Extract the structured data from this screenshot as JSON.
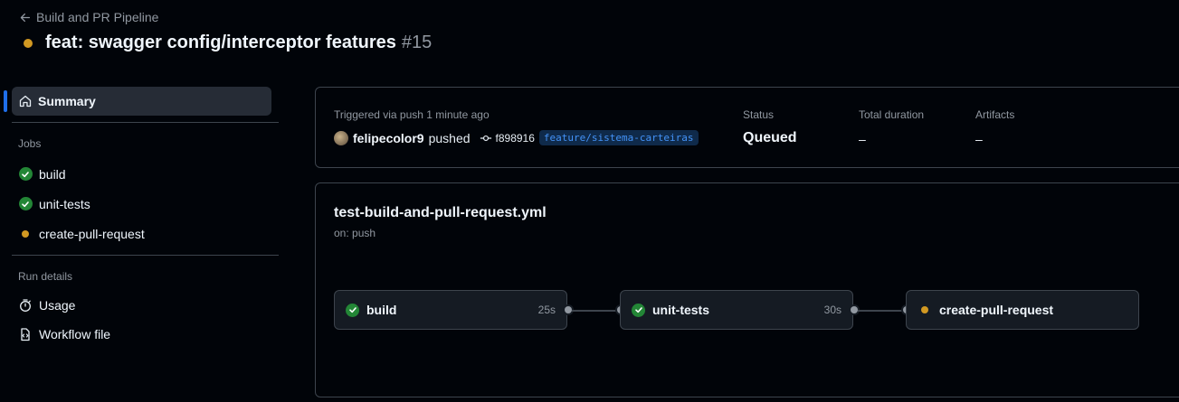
{
  "header": {
    "back_label": "Build and PR Pipeline",
    "title": "feat: swagger config/interceptor features",
    "run_number": "#15",
    "status_color": "#d29922"
  },
  "sidebar": {
    "summary_label": "Summary",
    "jobs_heading": "Jobs",
    "jobs": [
      {
        "label": "build",
        "status": "success"
      },
      {
        "label": "unit-tests",
        "status": "success"
      },
      {
        "label": "create-pull-request",
        "status": "queued"
      }
    ],
    "run_details_heading": "Run details",
    "usage_label": "Usage",
    "workflow_file_label": "Workflow file"
  },
  "run_info": {
    "triggered_label": "Triggered via push 1 minute ago",
    "user": "felipecolor9",
    "action": "pushed",
    "commit_sha": "f898916",
    "branch": "feature/sistema-carteiras",
    "status_label": "Status",
    "status_value": "Queued",
    "duration_label": "Total duration",
    "duration_value": "–",
    "artifacts_label": "Artifacts",
    "artifacts_value": "–"
  },
  "workflow": {
    "file_name": "test-build-and-pull-request.yml",
    "trigger": "on: push",
    "jobs": [
      {
        "name": "build",
        "duration": "25s",
        "status": "success"
      },
      {
        "name": "unit-tests",
        "duration": "30s",
        "status": "success"
      },
      {
        "name": "create-pull-request",
        "duration": "",
        "status": "queued"
      }
    ]
  },
  "colors": {
    "success": "#238636",
    "queued": "#d29922",
    "accent": "#1f6feb",
    "branch_text": "#4493f8"
  }
}
